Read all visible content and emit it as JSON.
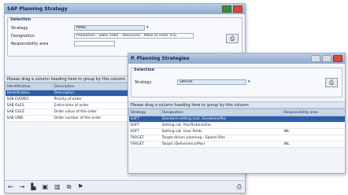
{
  "back_window": {
    "title": "SAP Planning Strategy",
    "group_label": "Selection",
    "fields": [
      {
        "label": "Strategy",
        "value": "MAKE",
        "has_dropdown": true
      },
      {
        "label": "Designation",
        "value": "Production - Sales order - Resources - Make to order (FS)",
        "has_dropdown": false
      },
      {
        "label": "Responsibility area",
        "value": "",
        "has_dropdown": false
      }
    ],
    "run_icon": "printer-icon",
    "hint": "Please drag a column heading here to group by this column",
    "table": {
      "columns": [
        "Identification",
        "Description"
      ],
      "rows": [
        {
          "id": "Identification",
          "desc": "Description",
          "selected": true
        },
        {
          "id": "SAB EVOPEC",
          "desc": "Priority of order"
        },
        {
          "id": "SAB OLES",
          "desc": "Entire time of order"
        },
        {
          "id": "SAB OLEZ",
          "desc": "Order value of the order"
        },
        {
          "id": "SAB UNIE",
          "desc": "Order number of the order"
        }
      ]
    },
    "toolbar_icons": [
      "arrow-left-icon",
      "arrow-right-icon",
      "new-document-icon",
      "save-icon",
      "delete-icon",
      "copy-icon",
      "flag-icon",
      "print-icon"
    ]
  },
  "front_window": {
    "title": "P. Planning Strategies",
    "group_label": "Selection",
    "field": {
      "label": "Strategy",
      "value": "SIMTAR",
      "has_dropdown": true
    },
    "run_icon": "printer-icon",
    "hint": "Please drag a column heading here to group by this column",
    "table": {
      "columns": [
        "Strategy",
        "Designation",
        "Responsibility area"
      ],
      "rows": [
        {
          "strategy": "SOFT",
          "designation": "Standard setting mat. Durations/Pos",
          "area": "",
          "selected": true
        },
        {
          "strategy": "SOFT",
          "designation": "Setting cat. Pos/Tortoiseline",
          "area": ""
        },
        {
          "strategy": "SOFT",
          "designation": "Setting cat. User fields",
          "area": "INL"
        },
        {
          "strategy": "TARGET",
          "designation": "Target-driven planning - Speed (Pos",
          "area": ""
        },
        {
          "strategy": "TARGET",
          "designation": "Target (Deliverance/Pos)",
          "area": "INL"
        }
      ]
    }
  },
  "colors": {
    "titlebar_top": "#b9cbe3",
    "titlebar_bottom": "#90a9cc",
    "selection_row": "#2f5ea8",
    "window_bg": "#f1f4f8"
  }
}
